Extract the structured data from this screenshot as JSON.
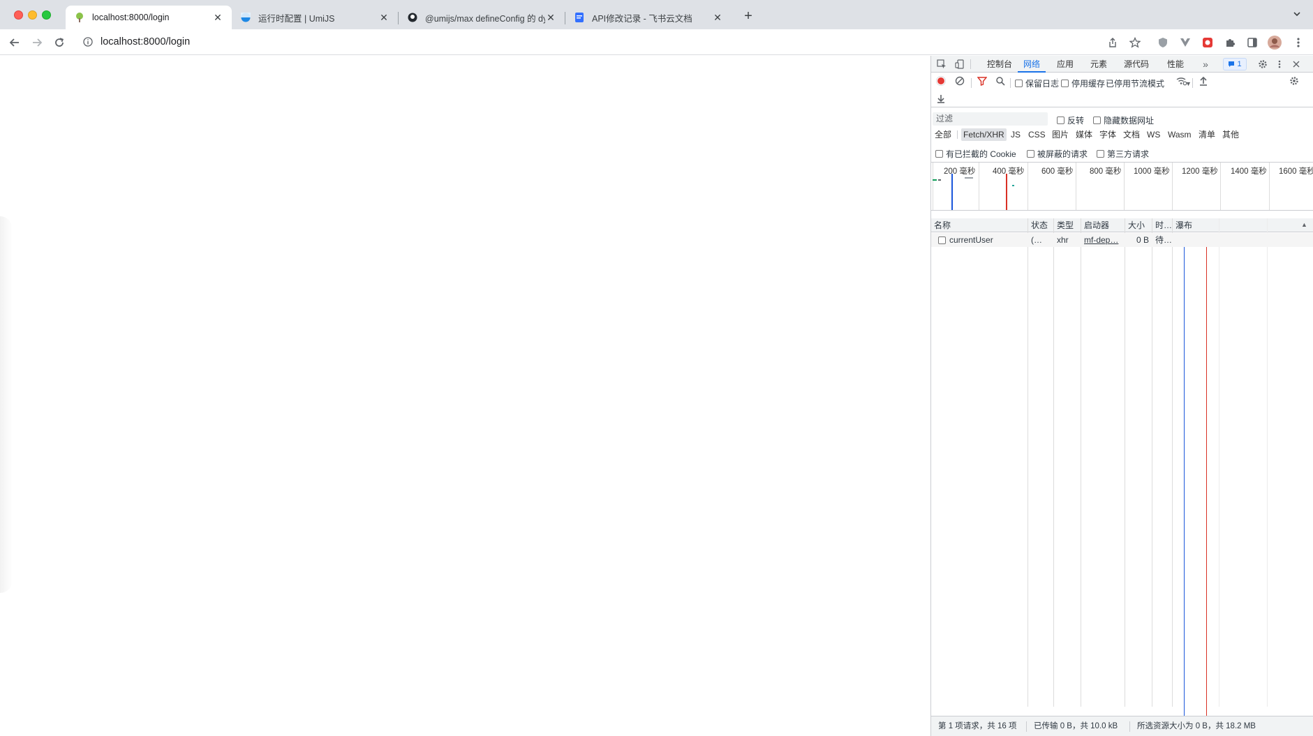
{
  "browser": {
    "tabs": [
      {
        "title": "localhost:8000/login",
        "favicon": "tree-icon",
        "active": true
      },
      {
        "title": "运行时配置 | UmiJS",
        "favicon": "umi-logo-icon",
        "active": false
      },
      {
        "title": "@umijs/max defineConfig 的 dy",
        "favicon": "github-icon",
        "active": false
      },
      {
        "title": "API修改记录 - 飞书云文档",
        "favicon": "doc-icon",
        "active": false
      }
    ],
    "url": "localhost:8000/login"
  },
  "devtools": {
    "tabs": [
      "控制台",
      "网络",
      "应用",
      "元素",
      "源代码",
      "性能"
    ],
    "active_tab": "网络",
    "issues_count": "1",
    "toolbar": {
      "preserve_log": "保留日志",
      "disable_cache": "停用缓存",
      "throttling": "已停用节流模式"
    },
    "filter": {
      "placeholder": "过滤",
      "invert": "反转",
      "hide_data_urls": "隐藏数据网址",
      "types": [
        "全部",
        "Fetch/XHR",
        "JS",
        "CSS",
        "图片",
        "媒体",
        "字体",
        "文档",
        "WS",
        "Wasm",
        "清单",
        "其他"
      ],
      "active_type": "Fetch/XHR",
      "blocked_cookies": "有已拦截的 Cookie",
      "blocked_requests": "被屏蔽的请求",
      "third_party": "第三方请求"
    },
    "overview": {
      "ticks": [
        "200 毫秒",
        "400 毫秒",
        "600 毫秒",
        "800 毫秒",
        "1000 毫秒",
        "1200 毫秒",
        "1400 毫秒",
        "1600 毫秒"
      ]
    },
    "table": {
      "columns": [
        "名称",
        "状态",
        "类型",
        "启动器",
        "大小",
        "时…",
        "瀑布"
      ],
      "rows": [
        {
          "name": "currentUser",
          "status": "(…",
          "type": "xhr",
          "initiator": "mf-dep…",
          "size": "0 B",
          "time": "待…"
        }
      ]
    },
    "status": {
      "requests": "第 1 项请求，共 16 项",
      "transferred": "已传输 0 B，共 10.0 kB",
      "resources": "所选资源大小为 0 B，共 18.2 MB"
    }
  }
}
